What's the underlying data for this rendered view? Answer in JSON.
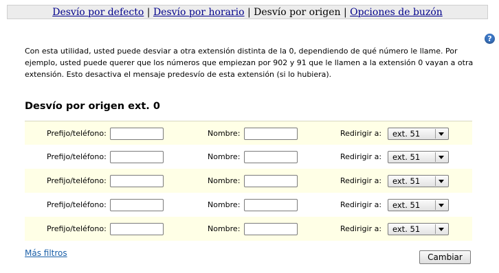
{
  "tabs": {
    "default_forward": "Desvío por defecto",
    "schedule_forward": "Desvío por horario",
    "origin_forward": "Desvío por origen",
    "mailbox_options": "Opciones de buzón",
    "separator": "|"
  },
  "help": {
    "glyph": "?"
  },
  "intro_text": "Con esta utilidad, usted puede desviar a otra extensión distinta de la 0, dependiendo de qué número le llame. Por ejemplo, usted puede querer que los números que empiezan por 902 y 91 que le llamen a la extensión 0 vayan a otra extensión. Esto desactiva el mensaje predesvío de esta extensión (si lo hubiera).",
  "section_title": "Desvío por origen ext. 0",
  "filters": [
    {
      "prefix_label": "Prefijo/teléfono:",
      "prefix_value": "",
      "name_label": "Nombre:",
      "name_value": "",
      "redirect_label": "Redirigir a:",
      "redirect_value": "ext. 51"
    },
    {
      "prefix_label": "Prefijo/teléfono:",
      "prefix_value": "",
      "name_label": "Nombre:",
      "name_value": "",
      "redirect_label": "Redirigir a:",
      "redirect_value": "ext. 51"
    },
    {
      "prefix_label": "Prefijo/teléfono:",
      "prefix_value": "",
      "name_label": "Nombre:",
      "name_value": "",
      "redirect_label": "Redirigir a:",
      "redirect_value": "ext. 51"
    },
    {
      "prefix_label": "Prefijo/teléfono:",
      "prefix_value": "",
      "name_label": "Nombre:",
      "name_value": "",
      "redirect_label": "Redirigir a:",
      "redirect_value": "ext. 51"
    },
    {
      "prefix_label": "Prefijo/teléfono:",
      "prefix_value": "",
      "name_label": "Nombre:",
      "name_value": "",
      "redirect_label": "Redirigir a:",
      "redirect_value": "ext. 51"
    }
  ],
  "more_filters": "Más filtros",
  "submit_label": "Cambiar",
  "colors": {
    "link": "#00008b",
    "row_highlight": "#ffffe6",
    "help_icon": "#3b76c4"
  }
}
